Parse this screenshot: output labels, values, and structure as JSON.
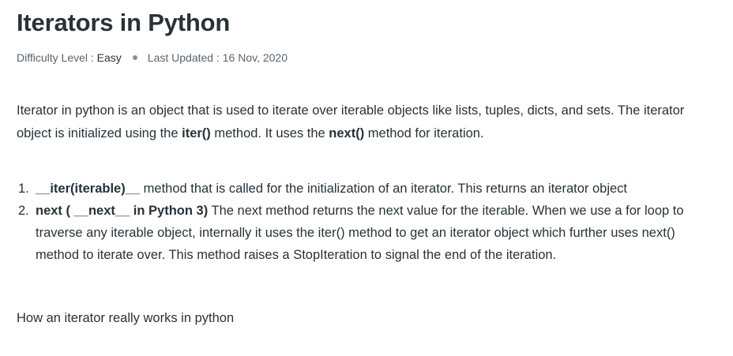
{
  "article": {
    "title": "Iterators in Python",
    "meta": {
      "difficulty_label": "Difficulty Level : ",
      "difficulty_value": "Easy",
      "updated_label": "Last Updated : ",
      "updated_value": "16 Nov, 2020"
    },
    "intro": {
      "part1": "Iterator in python is an object that is used to iterate over iterable objects like lists, tuples, dicts, and sets. The iterator object is initialized using the ",
      "code1": "iter()",
      "part2": " method. It uses the ",
      "code2": "next()",
      "part3": " method for iteration."
    },
    "list": [
      {
        "number": "1.",
        "term": "__iter(iterable)__",
        "text": " method that is called for the initialization of an iterator. This returns an iterator object"
      },
      {
        "number": "2.",
        "term": "next ( __next__ in Python 3)",
        "text": " The next method returns the next value for the iterable. When we use a for loop to traverse any iterable object, internally it uses the iter() method to get an iterator object which further uses next() method to iterate over. This method raises a StopIteration to signal the end of the iteration."
      }
    ],
    "closing": "How an iterator really works in python"
  }
}
